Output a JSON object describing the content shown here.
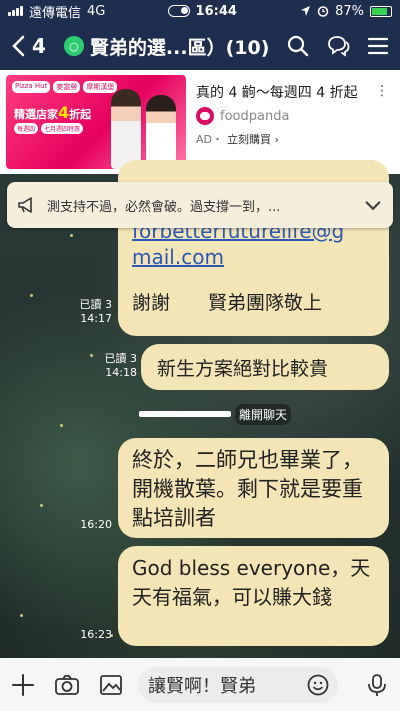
{
  "status_bar": {
    "carrier": "遠傳電信",
    "network": "4G",
    "time": "16:44",
    "battery": "87%"
  },
  "header": {
    "back_count": "4",
    "group_badge": "○",
    "title": "賢弟的選...區）(10)"
  },
  "ad": {
    "logos": [
      "Pizza Hut",
      "麥當勞",
      "摩斯漢堡"
    ],
    "headline_prefix": "精選店家",
    "headline_number": "4",
    "headline_suffix": "折起",
    "chips": [
      "每週四",
      "七月週四特惠"
    ],
    "title": "真的 4 齣～每週四 4 折起",
    "brand": "foodpanda",
    "label": "AD・",
    "cta": "立刻購買 ›"
  },
  "notice": {
    "text": "測支持不過，必然會破。過支撐一到，..."
  },
  "messages": [
    {
      "id": "m1",
      "lines": [
        "forbetterfuturelife@g",
        "mail.com",
        "謝謝　　賢弟團隊敬上"
      ],
      "read": "已讀 3",
      "time": "14:17"
    },
    {
      "id": "m2",
      "text": "新生方案絕對比較貴",
      "read": "已讀 3",
      "time": "14:18"
    },
    {
      "id": "m3",
      "text": "終於，二師兄也畢業了，開機散葉。剩下就是要重點培訓者",
      "time": "16:20"
    },
    {
      "id": "m4",
      "text": "God bless everyone，天天有福氣，可以賺大錢",
      "time": "16:23"
    }
  ],
  "system_message": {
    "text": "離開聊天"
  },
  "input": {
    "value": "讓賢啊！賢弟"
  },
  "colors": {
    "header_bg": "#1f2e4e",
    "bubble_bg": "#f4e5b6",
    "link": "#2a58b8"
  }
}
